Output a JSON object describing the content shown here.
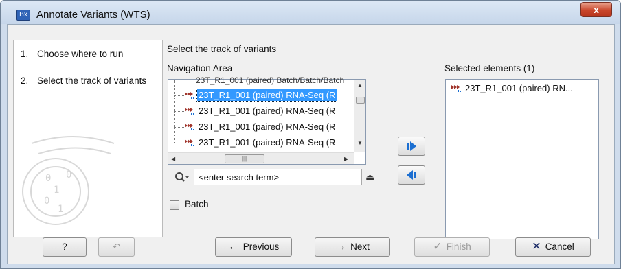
{
  "window": {
    "title": "Annotate Variants (WTS)",
    "app_icon_text": "Bx",
    "close_label": "x"
  },
  "steps": [
    {
      "num": "1.",
      "label": "Choose where to run"
    },
    {
      "num": "2.",
      "label": "Select the track of variants"
    }
  ],
  "main": {
    "section_title": "Select the track of variants",
    "navigation_label": "Navigation Area",
    "selected_label": "Selected elements (1)",
    "tree_cut_text": "23T_R1_001 (paired) Batch/Batch/Batch",
    "tree_items": [
      {
        "label": "23T_R1_001 (paired) RNA-Seq (R",
        "selected": true
      },
      {
        "label": "23T_R1_001 (paired) RNA-Seq (R",
        "selected": false
      },
      {
        "label": "23T_R1_001 (paired) RNA-Seq (R",
        "selected": false
      },
      {
        "label": "23T_R1_001 (paired) RNA-Seq (R",
        "selected": false
      }
    ],
    "search": {
      "placeholder": "<enter search term>",
      "value": "<enter search term>"
    },
    "batch_label": "Batch",
    "batch_checked": false,
    "selected_items": [
      {
        "label": "23T_R1_001 (paired) RN..."
      }
    ]
  },
  "footer": {
    "help_label": "?",
    "previous_label": "Previous",
    "next_label": "Next",
    "finish_label": "Finish",
    "cancel_label": "Cancel"
  },
  "colors": {
    "selection": "#3399ff",
    "arrow_blue": "#1c6fd1",
    "cancel_x": "#1a2a66"
  },
  "icons": [
    "variant-track-icon",
    "search-icon",
    "eject-icon",
    "right-arrow-icon",
    "left-arrow-icon",
    "help-icon",
    "reset-icon"
  ]
}
